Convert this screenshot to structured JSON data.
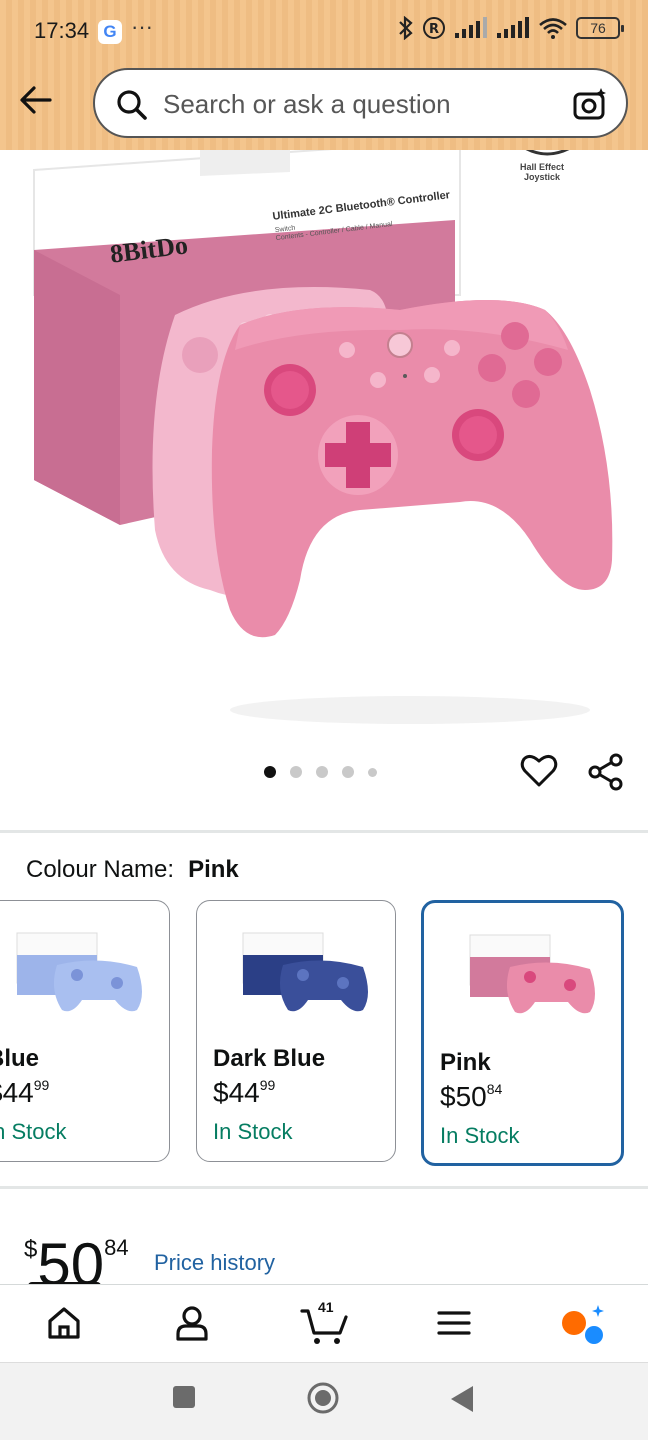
{
  "status_bar": {
    "time": "17:34",
    "g_label": "G",
    "dots": "···",
    "battery": "76"
  },
  "header": {
    "search_placeholder": "Search or ask a question"
  },
  "product_image": {
    "brand": "8BitDo",
    "box_title": "Ultimate 2C Bluetooth® Controller",
    "box_subtitle_1": "Switch",
    "box_subtitle_2": "Contents - Controller / Cable / Manual",
    "badge": "Hall Effect\nJoystick",
    "page_count": 5,
    "active_page": 1
  },
  "colour": {
    "label": "Colour Name:",
    "selected": "Pink"
  },
  "swatches": [
    {
      "name": "Blue",
      "price_whole": "44",
      "price_cents": "99",
      "stock": "In Stock",
      "color": "#9db4ea"
    },
    {
      "name": "Dark Blue",
      "price_whole": "44",
      "price_cents": "99",
      "stock": "In Stock",
      "color": "#2b3f86"
    },
    {
      "name": "Pink",
      "price_whole": "50",
      "price_cents": "84",
      "stock": "In Stock",
      "color": "#e98aa5"
    }
  ],
  "price": {
    "currency": "$",
    "whole": "50",
    "cents": "84",
    "history_link": "Price history"
  },
  "bottom_nav": {
    "cart_count": "41"
  },
  "colors": {
    "header_band": "#f4c58d",
    "link": "#2162a1",
    "in_stock": "#067d62",
    "selected_border": "#2162a1"
  }
}
